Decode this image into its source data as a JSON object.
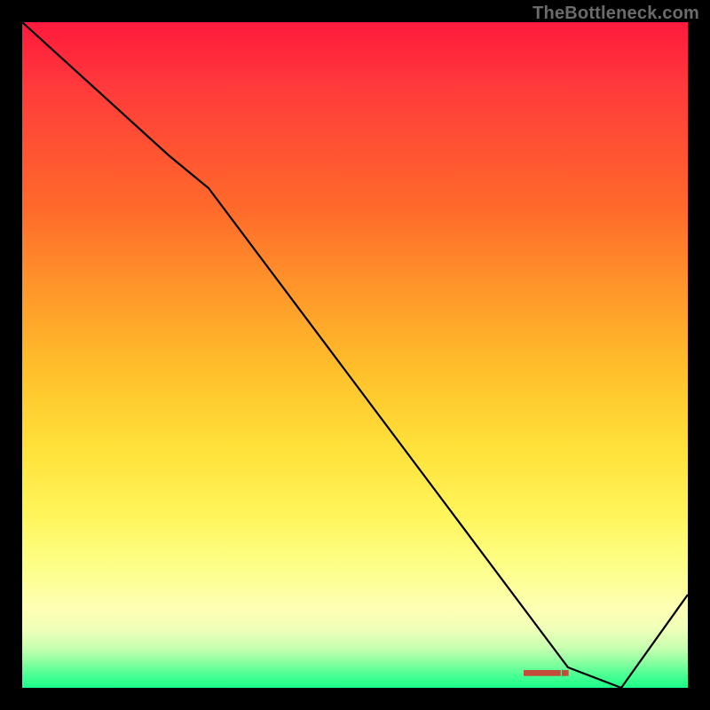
{
  "attribution": "TheBottleneck.com",
  "marker_text": "▀▀▀▀▀▀ ▀",
  "chart_data": {
    "type": "line",
    "title": "",
    "xlabel": "",
    "ylabel": "",
    "xlim": [
      0,
      100
    ],
    "ylim": [
      0,
      100
    ],
    "grid": false,
    "legend": false,
    "series": [
      {
        "name": "curve",
        "x": [
          0,
          22,
          28,
          82,
          90,
          100
        ],
        "values": [
          100,
          80,
          75,
          3,
          0,
          14
        ]
      }
    ],
    "annotations": [
      {
        "name": "result-marker",
        "x": 83,
        "y": 1,
        "text": "▀▀▀▀▀▀ ▀"
      }
    ],
    "background_gradient_note": "vertical red→yellow→green heatmap"
  }
}
